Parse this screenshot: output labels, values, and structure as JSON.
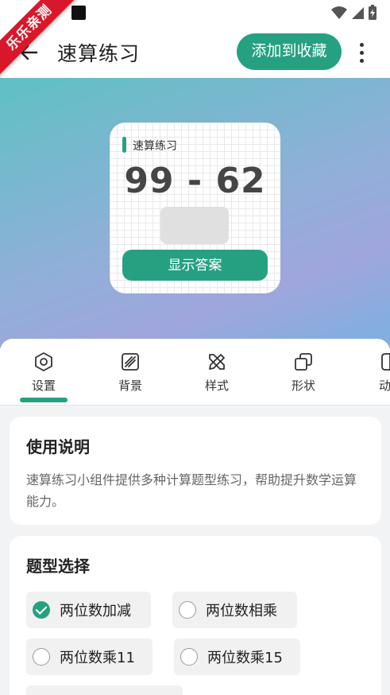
{
  "ribbon": {
    "text": "乐乐亲测"
  },
  "header": {
    "title": "速算练习",
    "favorite_label": "添加到收藏"
  },
  "widget": {
    "label": "速算练习",
    "question": "99 - 62",
    "show_answer_label": "显示答案"
  },
  "tabs": [
    {
      "label": "设置",
      "icon": "hexagon-settings-icon"
    },
    {
      "label": "背景",
      "icon": "background-stripes-icon"
    },
    {
      "label": "样式",
      "icon": "pencil-ruler-icon"
    },
    {
      "label": "形状",
      "icon": "shapes-icon"
    },
    {
      "label": "动",
      "icon": "animation-icon"
    }
  ],
  "usage": {
    "title": "使用说明",
    "description": "速算练习小组件提供多种计算题型练习，帮助提升数学运算能力。"
  },
  "question_types": {
    "title": "题型选择",
    "options": [
      {
        "label": "两位数加减",
        "checked": true
      },
      {
        "label": "两位数相乘",
        "checked": false
      },
      {
        "label": "两位数乘11",
        "checked": false
      },
      {
        "label": "两位数乘15",
        "checked": false
      }
    ]
  },
  "colors": {
    "accent": "#25a182",
    "ribbon": "#d9172a"
  }
}
